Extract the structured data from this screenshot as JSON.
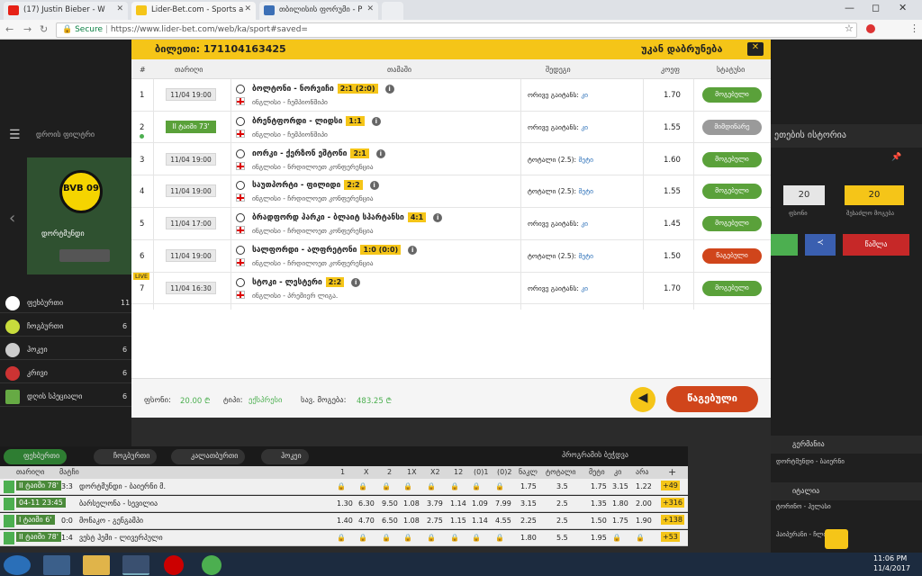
{
  "browser": {
    "tabs": [
      {
        "title": "(17) Justin Bieber - W",
        "close": "✕"
      },
      {
        "title": "Lider-Bet.com - Sports a",
        "close": "✕"
      },
      {
        "title": "თბილისის ფორუმი - P",
        "close": "✕"
      }
    ],
    "secure_label": "Secure",
    "url": "https://www.lider-bet.com/web/ka/sport#saved="
  },
  "modal": {
    "ticket_label": "ბილეთი: 171104163425",
    "back_label": "უკან დაბრუნება",
    "columns": {
      "num": "#",
      "date": "თარიღი",
      "match": "თამაში",
      "result": "შედეგი",
      "coef": "კოეფ",
      "status": "სტატუსი"
    },
    "rows": [
      {
        "num": "1",
        "date": "11/04 19:00",
        "teams": "ბოლტონი - ნორვიჩი",
        "score": "2:1 (2:0)",
        "league": "ინგლისი - ჩემპიონშიპი",
        "bet_label": "ორივე გაიტანს:",
        "bet_value": "კი",
        "coef": "1.70",
        "status": "მოგებული",
        "status_color": "#5aa13a"
      },
      {
        "num": "2",
        "date": "II ტაიმი 73'",
        "teams": "ბრენტფორდი - ლიდსი",
        "score": "1:1",
        "league": "ინგლისი - ჩემპიონშიპი",
        "bet_label": "ორივე გაიტანს:",
        "bet_value": "კი",
        "coef": "1.55",
        "status": "მიმდინარე",
        "status_color": "#9a9a9a"
      },
      {
        "num": "3",
        "date": "11/04 19:00",
        "teams": "იორკი - ქერზონ ეშტონი",
        "score": "2:1",
        "league": "ინგლისი - ნრდილოეთ კონფერენცია",
        "bet_label": "ტოტალი (2.5):",
        "bet_value": "მეტი",
        "coef": "1.60",
        "status": "მოგებული",
        "status_color": "#5aa13a"
      },
      {
        "num": "4",
        "date": "11/04 19:00",
        "teams": "საუთპორტი - ფილიდი",
        "score": "2:2",
        "league": "ინგლისი - ჩრდილოეთ კონფერენცია",
        "bet_label": "ტოტალი (2.5):",
        "bet_value": "მეტი",
        "coef": "1.55",
        "status": "მოგებული",
        "status_color": "#5aa13a"
      },
      {
        "num": "5",
        "date": "11/04 17:00",
        "teams": "ბრადფორდ პარკი - ბლაიტ სპარტანსი",
        "score": "4:1",
        "league": "ინგლისი - ჩრდილოეთ კონფერენცია",
        "bet_label": "ორივე გაიტანს:",
        "bet_value": "კი",
        "coef": "1.45",
        "status": "მოგებული",
        "status_color": "#5aa13a"
      },
      {
        "num": "6",
        "date": "11/04 19:00",
        "teams": "სალფორდი - ალფრეტონი",
        "score": "1:0 (0:0)",
        "league": "ინგლისი - ჩრდილოეთ კონფერენცია",
        "bet_label": "ტოტალი (2.5):",
        "bet_value": "მეტი",
        "coef": "1.50",
        "status": "წაგებული",
        "status_color": "#d0451b"
      },
      {
        "num": "7",
        "date": "11/04 16:30",
        "teams": "სტოკი - ლესტერი",
        "score": "2:2",
        "league": "ინგლისი - პრემიერ ლიგა.",
        "bet_label": "ორივე გაიტანს:",
        "bet_value": "კი",
        "coef": "1.70",
        "status": "მოგებული",
        "status_color": "#5aa13a",
        "live": "LIVE"
      }
    ],
    "footer": {
      "stake_label": "ფსონი:",
      "stake_value": "20.00 ₾",
      "type_label": "ტიპი:",
      "type_value": "ექსპრესი",
      "possible_label": "სავ. მოგება:",
      "possible_value": "483.25 ₾",
      "result_button": "წაგებული"
    }
  },
  "left": {
    "filter_label": "დროის ფილტრი",
    "promo_text": "დორტმუნდი",
    "promo_logo": "BVB 09",
    "sports": [
      {
        "name": "ფეხბურთი",
        "count": "11"
      },
      {
        "name": "ჩოგბურთი",
        "count": "6"
      },
      {
        "name": "ჰოკეი",
        "count": "6"
      },
      {
        "name": "კრივი",
        "count": "6"
      },
      {
        "name": "დღის სპეციალი",
        "count": "6"
      }
    ]
  },
  "right": {
    "history_title": "ეთების ისტორია",
    "value1": "20",
    "value2": "20",
    "label1": "ფსონი",
    "label2": "შესაძლო მოგება",
    "delete_button": "წაშლა",
    "country1": "გერმანია",
    "country2": "იტალია",
    "match1": "დორტმუნდი - ბაიერნი",
    "match2": "ტორინო - ჰელასი",
    "match3": "ჰაიპერანი - ჩლიოჩი"
  },
  "bottom": {
    "tabs": [
      "ფეხბურთი",
      "ჩოგბურთი",
      "კალათბურთი",
      "ჰოკეი"
    ],
    "print_label": "პროგრამის ბეჭდვა",
    "header": [
      "თარიღი",
      "მატჩი",
      "1",
      "X",
      "2",
      "1X",
      "X2",
      "12",
      "(0)1",
      "(0)2",
      "ნაკლ",
      "ტოტალი",
      "მეტი",
      "კი",
      "არა",
      "+"
    ],
    "rows": [
      {
        "time": "II ტაიმი 78'",
        "score": "3:3",
        "match": "დორტმუნდი - ბაიერნი მ.",
        "odds": [
          "",
          "",
          "",
          "",
          "",
          "",
          "",
          "",
          "1.75",
          "3.5",
          "1.75",
          "3.15",
          "1.22"
        ],
        "more": "+49"
      },
      {
        "time": "04-11 23:45",
        "score": "",
        "match": "ბარსელონა - სევილია",
        "odds": [
          "1.30",
          "6.30",
          "9.50",
          "1.08",
          "3.79",
          "1.14",
          "1.09",
          "7.99",
          "3.15",
          "2.5",
          "1.35",
          "1.80",
          "2.00"
        ],
        "more": "+316"
      },
      {
        "time": "I ტაიმი 6'",
        "score": "0:0",
        "match": "მონაკო - გენგამპი",
        "odds": [
          "1.40",
          "4.70",
          "6.50",
          "1.08",
          "2.75",
          "1.15",
          "1.14",
          "4.55",
          "2.25",
          "2.5",
          "1.50",
          "1.75",
          "1.90"
        ],
        "more": "+138"
      },
      {
        "time": "II ტაიმი 78'",
        "score": "1:4",
        "match": "ვესტ ჰემი - ლივერპული",
        "odds": [
          "",
          "",
          "",
          "",
          "",
          "",
          "",
          "",
          "1.80",
          "5.5",
          "1.95",
          "",
          ""
        ],
        "more": "+53"
      }
    ]
  },
  "taskbar": {
    "time": "11:06 PM",
    "date": "11/4/2017"
  }
}
